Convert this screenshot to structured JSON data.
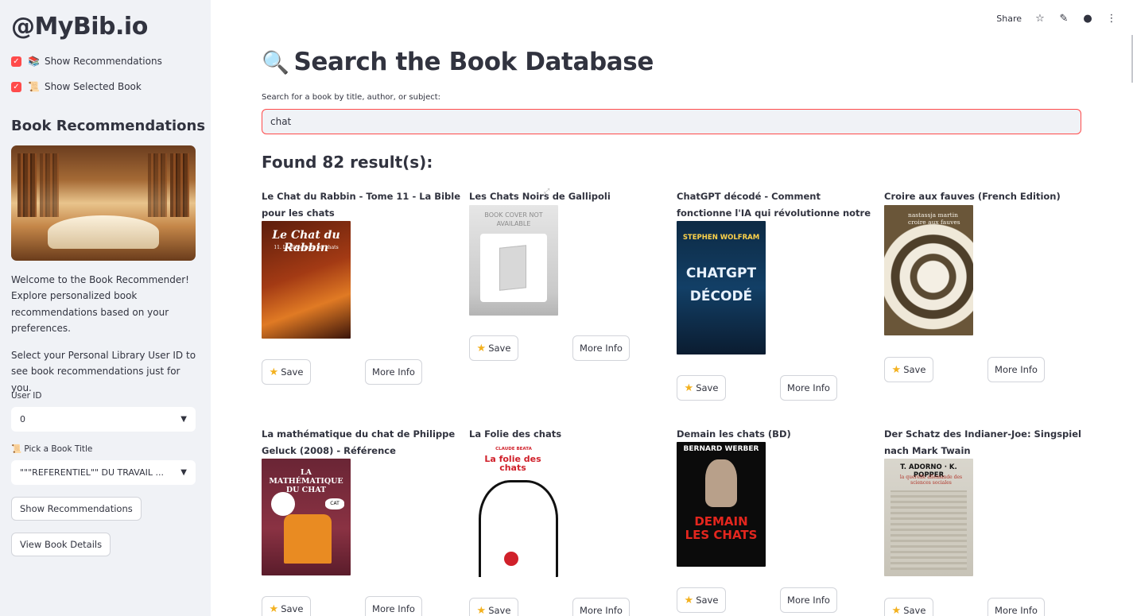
{
  "sidebar": {
    "brand": "@MyBib.io",
    "toggles": [
      {
        "emoji": "📚",
        "label": "Show Recommendations",
        "checked": true
      },
      {
        "emoji": "📜",
        "label": "Show Selected Book",
        "checked": true
      }
    ],
    "heading": "Book Recommendations",
    "intro": "Welcome to the Book Recommender! Explore personalized book recommendations based on your preferences.",
    "instruction": "Select your Personal Library User ID to see book recommendations just for you.",
    "user_id_label": "User ID",
    "user_id_value": "0",
    "pick_label": "📜 Pick a Book Title",
    "pick_value": "\"\"\"REFERENTIEL\"\" DU TRAVAIL ...",
    "show_recs_button": "Show Recommendations",
    "view_details_button": "View Book Details"
  },
  "topbar": {
    "share": "Share"
  },
  "main": {
    "title_icon": "🔍",
    "title": "Search the Book Database",
    "search_label": "Search for a book by title, author, or subject:",
    "search_value": "chat",
    "found": "Found 82 result(s):"
  },
  "buttons": {
    "save": "Save",
    "more": "More Info"
  },
  "books": [
    {
      "title": "Le Chat du Rabbin - Tome 11 - La Bible pour les chats",
      "cover_text": "Le Chat du Rabbin",
      "cover_sub": "11. La Bible pour les chats"
    },
    {
      "title": "Les Chats Noirs de Gallipoli",
      "cover_text": "BOOK COVER NOT AVAILABLE",
      "cover_sub": ""
    },
    {
      "title": "ChatGPT décodé - Comment fonctionne l'IA qui révolutionne notre monde ?",
      "cover_text": "STEPHEN WOLFRAM",
      "cover_sub": "CHATGPT DÉCODÉ"
    },
    {
      "title": "Croire aux fauves (French Edition)",
      "cover_text": "nastassja martin croire aux fauves",
      "cover_sub": ""
    },
    {
      "title": "La mathématique du chat de Philippe Geluck (2008) - Référence",
      "cover_text": "LA MATHÉMATIQUE DU CHAT",
      "cover_sub": "CAT"
    },
    {
      "title": "La Folie des chats",
      "cover_text": "La folie des chats",
      "cover_sub": "CLAUDE BEATA"
    },
    {
      "title": "Demain les chats (BD)",
      "cover_text": "BERNARD WERBER",
      "cover_sub": "DEMAIN LES CHATS"
    },
    {
      "title": "Der Schatz des Indianer-Joe: Singspiel nach Mark Twain",
      "cover_text": "T. ADORNO · K. POPPER",
      "cover_sub": "la querelle allemande des sciences sociales"
    }
  ],
  "colors": {
    "accent": "#ff4b4b",
    "sidebar_bg": "#f0f2f6",
    "text": "#31333f"
  }
}
